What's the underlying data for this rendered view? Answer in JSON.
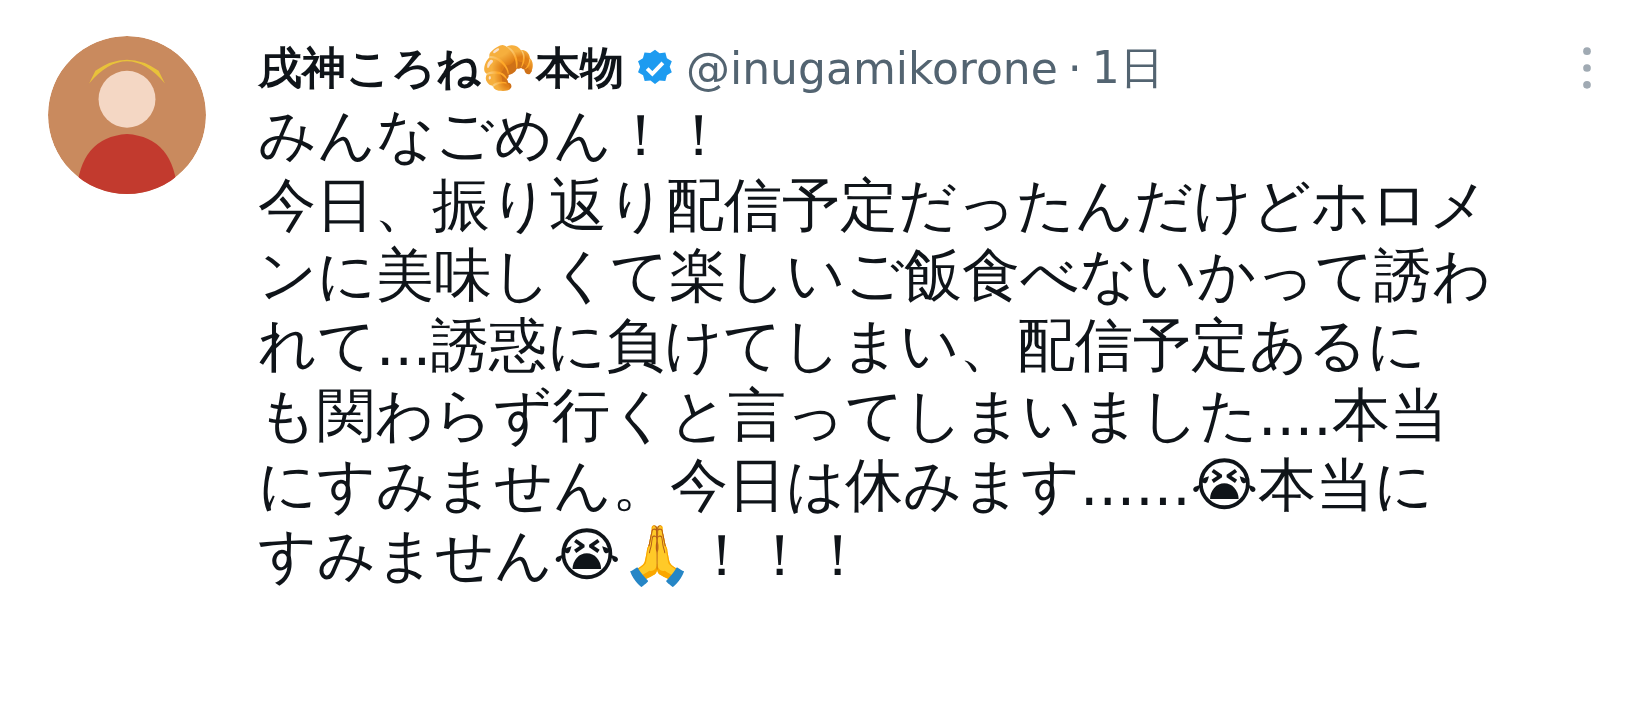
{
  "post": {
    "author_name": "戌神ころね🥐本物",
    "verified": true,
    "handle": "@inugamikorone",
    "separator": "·",
    "time": "1日",
    "body_lines": [
      "みんなごめん！！",
      "今日、振り返り配信予定だったんだけどホロメ",
      "ンに美味しくて楽しいご飯食べないかって誘わ",
      "れて...誘惑に負けてしまい、配信予定あるに",
      "も関わらず行くと言ってしまいました....本当",
      "にすみません。今日は休みます......😭本当に",
      "すみません😭🙏！！！"
    ]
  }
}
